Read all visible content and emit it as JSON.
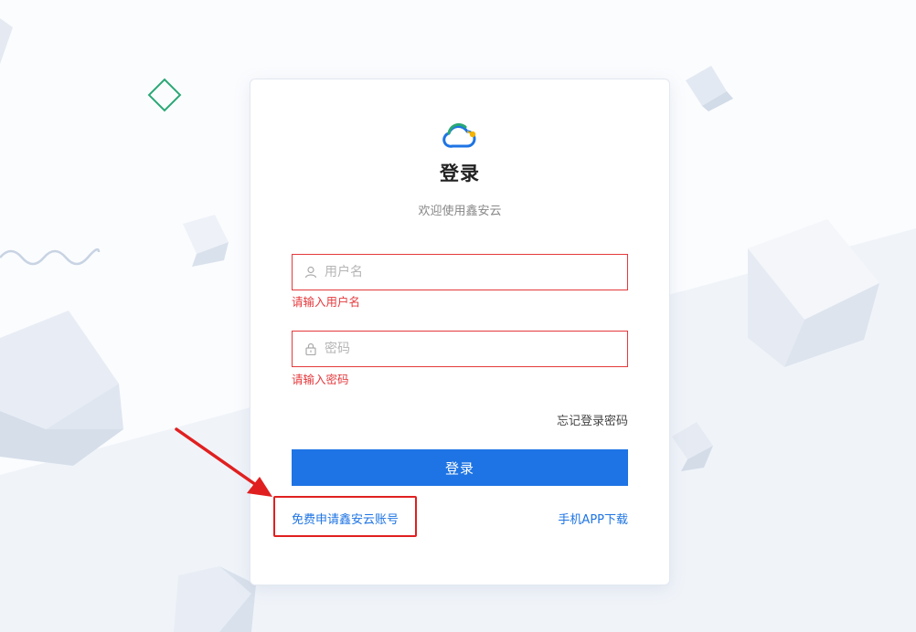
{
  "login": {
    "title": "登录",
    "subtitle": "欢迎使用鑫安云",
    "username": {
      "placeholder": "用户名",
      "value": "",
      "error": "请输入用户名"
    },
    "password": {
      "placeholder": "密码",
      "value": "",
      "error": "请输入密码"
    },
    "forgot_label": "忘记登录密码",
    "submit_label": "登录",
    "register_label": "免费申请鑫安云账号",
    "app_download_label": "手机APP下载"
  },
  "colors": {
    "accent": "#1e74e4",
    "error": "#e4393c",
    "annotation": "#e02020"
  },
  "icons": [
    "cloud-logo-icon",
    "user-icon",
    "lock-icon",
    "diamond-decor-icon",
    "wave-decor-icon",
    "cube-decor-icon"
  ]
}
